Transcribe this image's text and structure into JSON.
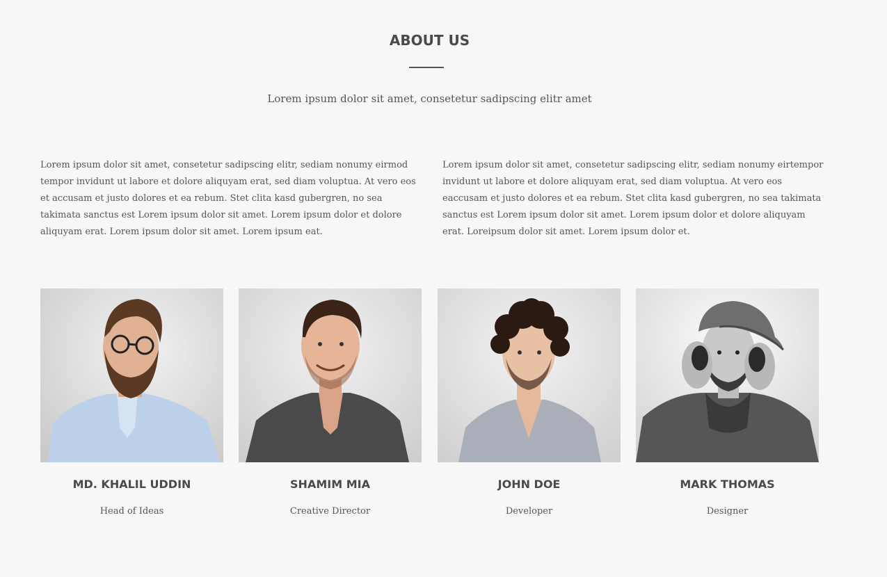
{
  "about": {
    "title": "ABOUT US",
    "subtitle": "Lorem ipsum dolor sit amet, consetetur sadipscing elitr amet",
    "paragraph_left": "Lorem ipsum dolor sit amet, consetetur sadipscing elitr, sediam nonumy eirmod tempor invidunt ut labore et dolore aliquyam erat, sed diam voluptua. At vero eos et accusam et justo dolores et ea rebum. Stet clita kasd gubergren, no sea takimata sanctus est Lorem ipsum dolor sit amet. Lorem ipsum dolor et dolore aliquyam erat. Lorem ipsum dolor sit amet. Lorem ipsum eat.",
    "paragraph_right": "Lorem ipsum dolor sit amet, consetetur sadipscing elitr, sediam nonumy eirtempor invidunt ut labore et dolore aliquyam erat, sed diam voluptua. At vero eos eaccusam et justo dolores et ea rebum. Stet clita kasd gubergren, no sea takimata sanctus est Lorem ipsum dolor sit amet. Lorem ipsum dolor et dolore aliquyam erat. Loreipsum dolor sit amet. Lorem ipsum dolor et."
  },
  "team": [
    {
      "name": "MD. KHALIL UDDIN",
      "role": "Head of Ideas",
      "photo_icon": "portrait-photo-glasses-beard"
    },
    {
      "name": "SHAMIM MIA",
      "role": "Creative Director",
      "photo_icon": "portrait-photo-smiling"
    },
    {
      "name": "JOHN DOE",
      "role": "Developer",
      "photo_icon": "portrait-photo-curly-hair"
    },
    {
      "name": "MARK THOMAS",
      "role": "Designer",
      "photo_icon": "portrait-photo-cap-headphones"
    }
  ],
  "colors": {
    "background": "#f7f7f7",
    "text": "#555555",
    "heading": "#4a4a4a"
  }
}
